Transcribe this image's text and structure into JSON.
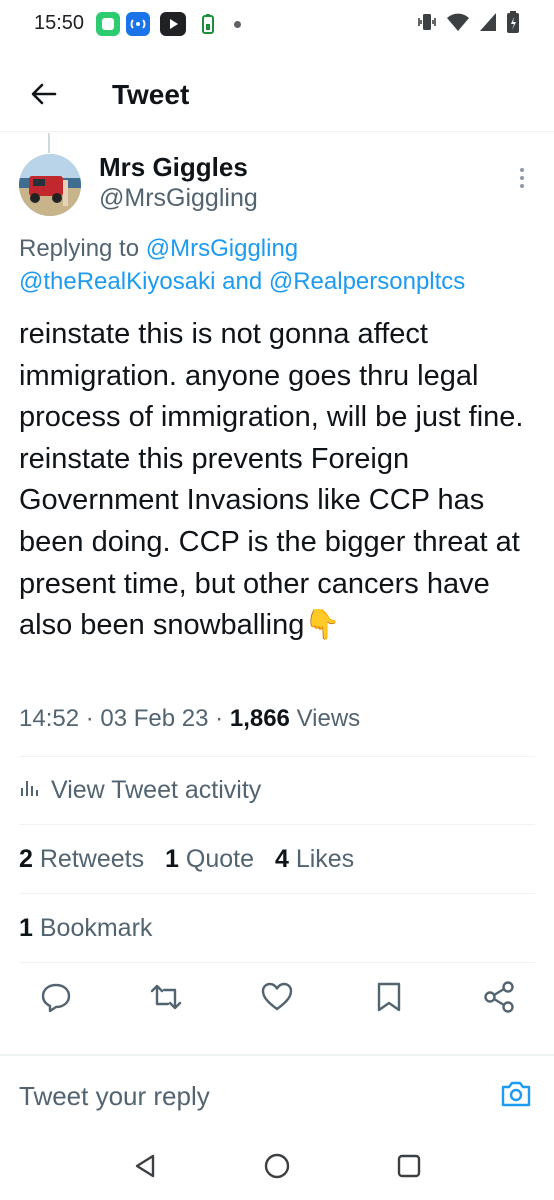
{
  "status_bar": {
    "time": "15:50",
    "left_icons": [
      "chat-app-icon",
      "hotspot-icon",
      "youtube-icon",
      "battery-saver-icon"
    ],
    "right_icons": [
      "vibrate-icon",
      "wifi-icon",
      "signal-icon",
      "battery-icon"
    ]
  },
  "header": {
    "title": "Tweet"
  },
  "tweet": {
    "display_name": "Mrs Giggles",
    "handle": "@MrsGiggling",
    "replying_prefix": "Replying to",
    "replying_to_1": "@MrsGiggling",
    "replying_to_2": "@theRealKiyosaki",
    "replying_and": "and",
    "replying_to_3": "@Realpersonpltcs",
    "text": "reinstate this is not gonna affect immigration. anyone goes thru legal process of immigration, will be just fine. reinstate this prevents Foreign Government Invasions like CCP has been doing. CCP is the bigger threat at present time, but other cancers have also been snowballing👇",
    "time": "14:52",
    "date": "03 Feb 23",
    "views_count": "1,866",
    "views_label": "Views",
    "separator": "·"
  },
  "activity": {
    "label": "View Tweet activity"
  },
  "stats": {
    "retweets_count": "2",
    "retweets_label": "Retweets",
    "quotes_count": "1",
    "quotes_label": "Quote",
    "likes_count": "4",
    "likes_label": "Likes",
    "bookmarks_count": "1",
    "bookmarks_label": "Bookmark"
  },
  "reply": {
    "placeholder": "Tweet your reply"
  },
  "colors": {
    "accent": "#1d9bf0",
    "text": "#0f1419",
    "secondary": "#536471",
    "divider": "#eff3f4"
  }
}
